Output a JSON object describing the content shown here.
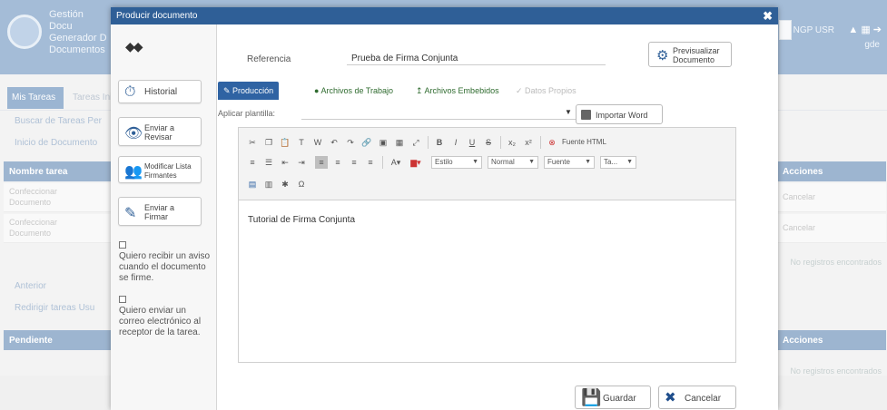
{
  "background": {
    "app_title_lines": [
      "Gestión Docu",
      "Generador D",
      "Documentos"
    ],
    "user_name": "NGP USR",
    "user_sub": "gde",
    "tabs": [
      "Mis Tareas",
      "Tareas Ini"
    ],
    "links": [
      "Buscar de Tareas Per",
      "Inicio de Documento",
      "Redirigir tareas Usu"
    ],
    "grid1_header": "Nombre tarea",
    "grid1_rows": [
      [
        "Confeccionar",
        "Documento"
      ],
      [
        "Confeccionar",
        "Documento"
      ]
    ],
    "grid1_right_header": "Acciones",
    "grid1_right_rows": [
      "Cancelar",
      "Cancelar"
    ],
    "grid2_header": "Pendiente",
    "grid2_right_header": "Acciones",
    "footer_text": "No registros encontrados",
    "status_row": "Anterior"
  },
  "modal": {
    "title": "Producir documento",
    "close_glyph": "✖",
    "mask_glyph": "👓",
    "sidebar_buttons": [
      {
        "icon": "⏱",
        "label": "Historial"
      },
      {
        "icon": "👁",
        "label": "Enviar a Revisar"
      },
      {
        "icon": "👥",
        "label": "Modificar Lista Firmantes"
      },
      {
        "icon": "✎",
        "label": "Enviar a Firmar"
      }
    ],
    "checkboxes": [
      {
        "label": "Quiero recibir un aviso cuando el documento se firme."
      },
      {
        "label": "Quiero enviar un correo electrónico al receptor de la tarea."
      }
    ],
    "reference_label": "Referencia",
    "reference_value": "Prueba de Firma Conjunta",
    "preview_button": {
      "icon": "⚙",
      "label": "Previsualizar Documento"
    },
    "editor_tabs": [
      {
        "label": "Producción",
        "state": "active"
      },
      {
        "label": "Archivos de Trabajo",
        "state": "normal"
      },
      {
        "label": "Archivos Embebidos",
        "state": "normal"
      },
      {
        "label": "Datos Propios",
        "state": "disabled"
      }
    ],
    "template_label": "Aplicar plantilla:",
    "import_button": "Importar Word",
    "toolbar": {
      "source_label": "Fuente HTML",
      "style_select": "Estilo",
      "format_select": "Normal",
      "font_select": "Fuente",
      "size_select": "Ta..."
    },
    "editor_content": "Tutorial de Firma Conjunta",
    "save_button": {
      "icon": "💾",
      "label": "Guardar"
    },
    "cancel_button": {
      "icon": "✖",
      "label": "Cancelar"
    }
  },
  "colors": {
    "header_blue": "#2f5f97",
    "active_tab": "#2f63a3",
    "cancel_icon": "#1f4e8c"
  }
}
